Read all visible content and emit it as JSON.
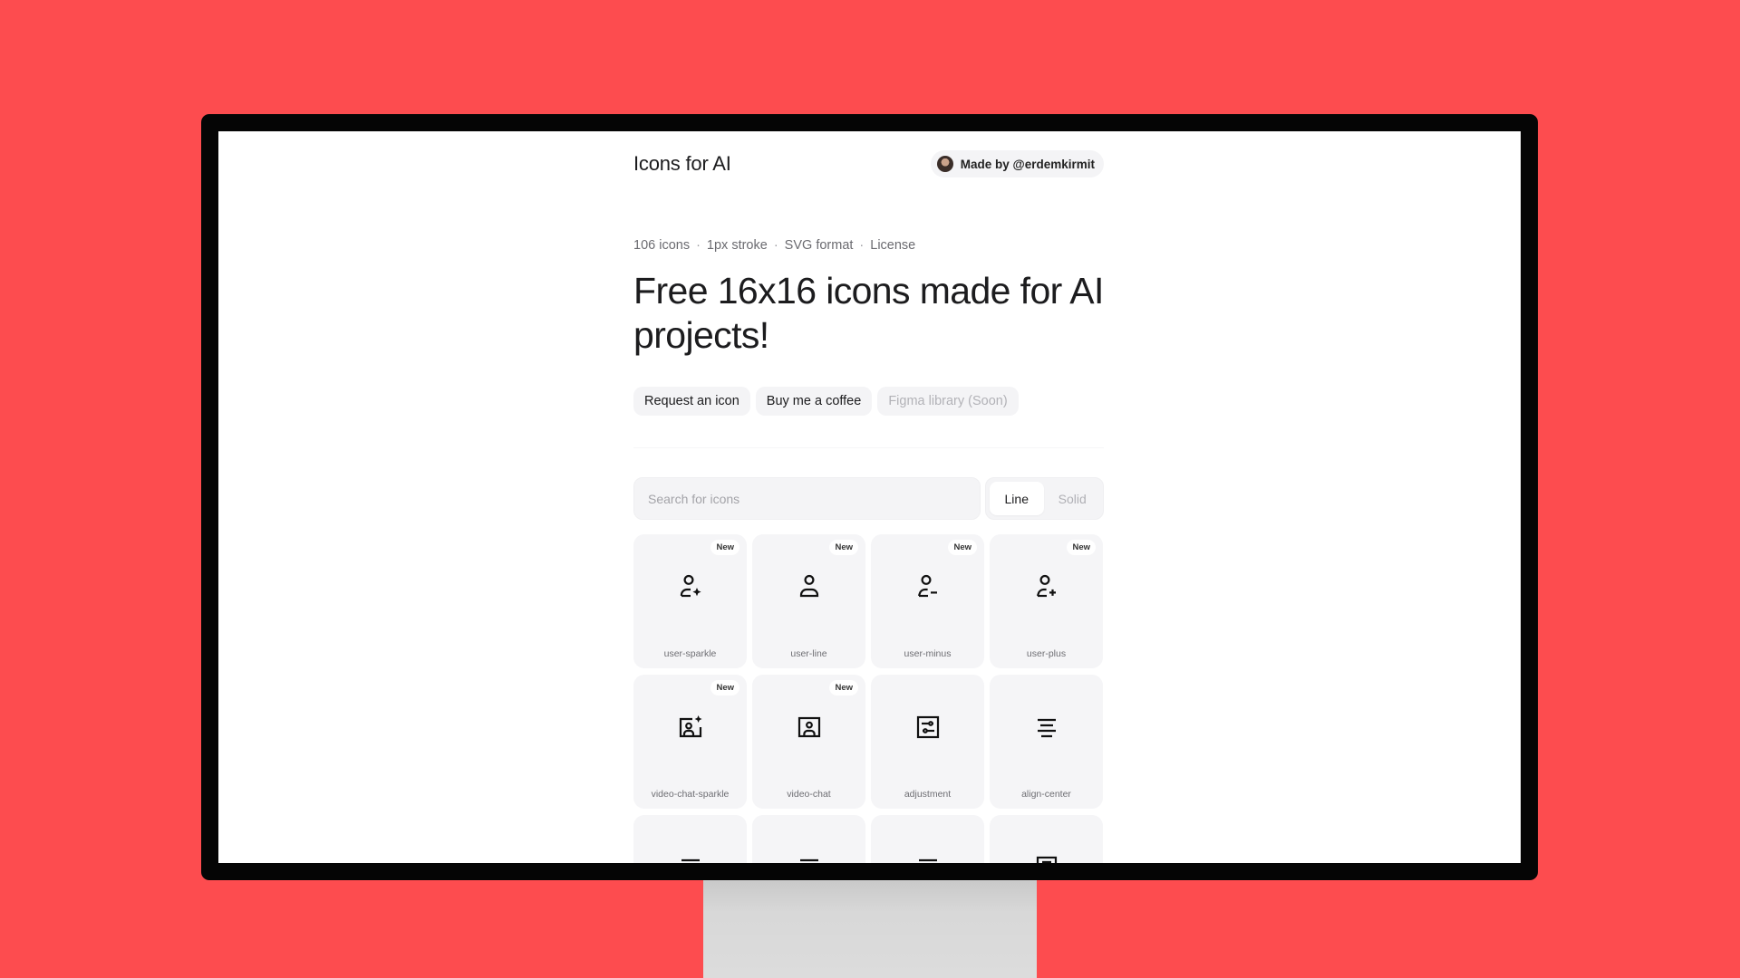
{
  "header": {
    "brand": "Icons for AI",
    "made_by": "Made by @erdemkirmit"
  },
  "meta": {
    "items": [
      "106 icons",
      "1px stroke",
      "SVG format",
      "License"
    ],
    "separator": "·"
  },
  "hero": {
    "headline": "Free 16x16 icons made for AI projects!"
  },
  "actions": {
    "request": "Request an icon",
    "coffee": "Buy me a coffee",
    "figma": "Figma library (Soon)"
  },
  "search": {
    "placeholder": "Search for icons",
    "value": ""
  },
  "style_toggle": {
    "options": [
      "Line",
      "Solid"
    ],
    "selected": "Line"
  },
  "icons": [
    {
      "name": "user-sparkle",
      "badge": "New",
      "icon": "user-sparkle-icon"
    },
    {
      "name": "user-line",
      "badge": "New",
      "icon": "user-line-icon"
    },
    {
      "name": "user-minus",
      "badge": "New",
      "icon": "user-minus-icon"
    },
    {
      "name": "user-plus",
      "badge": "New",
      "icon": "user-plus-icon"
    },
    {
      "name": "video-chat-sparkle",
      "badge": "New",
      "icon": "video-chat-sparkle-icon"
    },
    {
      "name": "video-chat",
      "badge": "New",
      "icon": "video-chat-icon"
    },
    {
      "name": "adjustment",
      "badge": "",
      "icon": "adjustment-icon"
    },
    {
      "name": "align-center",
      "badge": "",
      "icon": "align-center-icon"
    },
    {
      "name": "",
      "badge": "",
      "icon": "align-lines-icon"
    },
    {
      "name": "",
      "badge": "",
      "icon": "align-lines-icon"
    },
    {
      "name": "",
      "badge": "",
      "icon": "align-lines-icon"
    },
    {
      "name": "",
      "badge": "",
      "icon": "document-icon"
    }
  ],
  "colors": {
    "background": "#fd4c4f",
    "bezel": "#050505",
    "tile": "#f5f5f7",
    "text": "#1c1c1e"
  }
}
